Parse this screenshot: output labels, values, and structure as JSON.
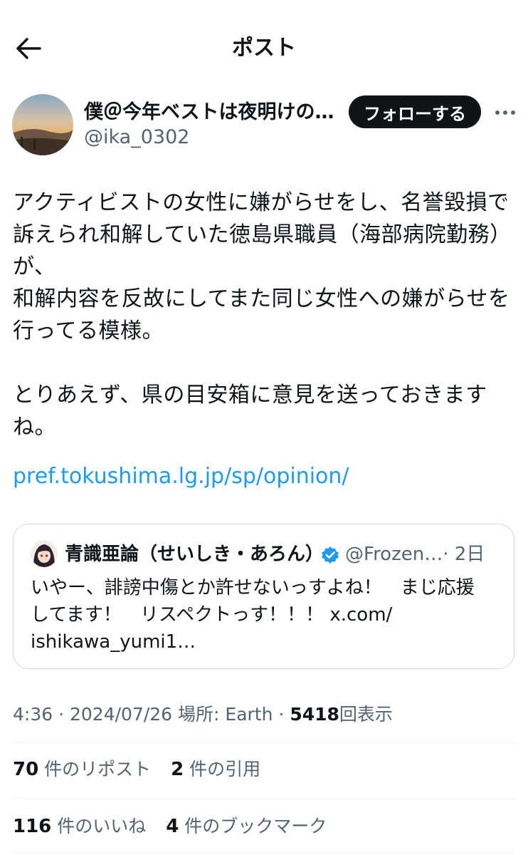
{
  "header": {
    "title": "ポスト"
  },
  "author": {
    "name": "僕＠今年ベストは夜明けの…",
    "handle": "@ika_0302",
    "follow_label": "フォローする"
  },
  "post": {
    "text": "アクティビストの女性に嫌がらせをし、名誉毀損で\n訴えられ和解していた徳島県職員（海部病院勤務）\nが、\n和解内容を反故にしてまた同じ女性への嫌がらせを\n行ってる模様。\n\nとりあえず、県の目安箱に意見を送っておきます\nね。",
    "link": "pref.tokushima.lg.jp/sp/opinion/"
  },
  "quote": {
    "name": "青識亜論（せいしき・あろん）",
    "handle": "@Frozen…",
    "time": "· 2日",
    "text": "いやー、誹謗中傷とか許せないっすよね！　まじ応援\nしてます！　リスペクトっす！！！ x.com/\nishikawa_yumi1…"
  },
  "meta": {
    "time": "4:36",
    "date": "2024/07/26",
    "location": "場所: Earth",
    "views_count": "5418",
    "views_label": "回表示"
  },
  "stats": {
    "reposts_count": "70",
    "reposts_label": "件のリポスト",
    "quotes_count": "2",
    "quotes_label": "件の引用",
    "likes_count": "116",
    "likes_label": "件のいいね",
    "bookmarks_count": "4",
    "bookmarks_label": "件のブックマーク"
  }
}
